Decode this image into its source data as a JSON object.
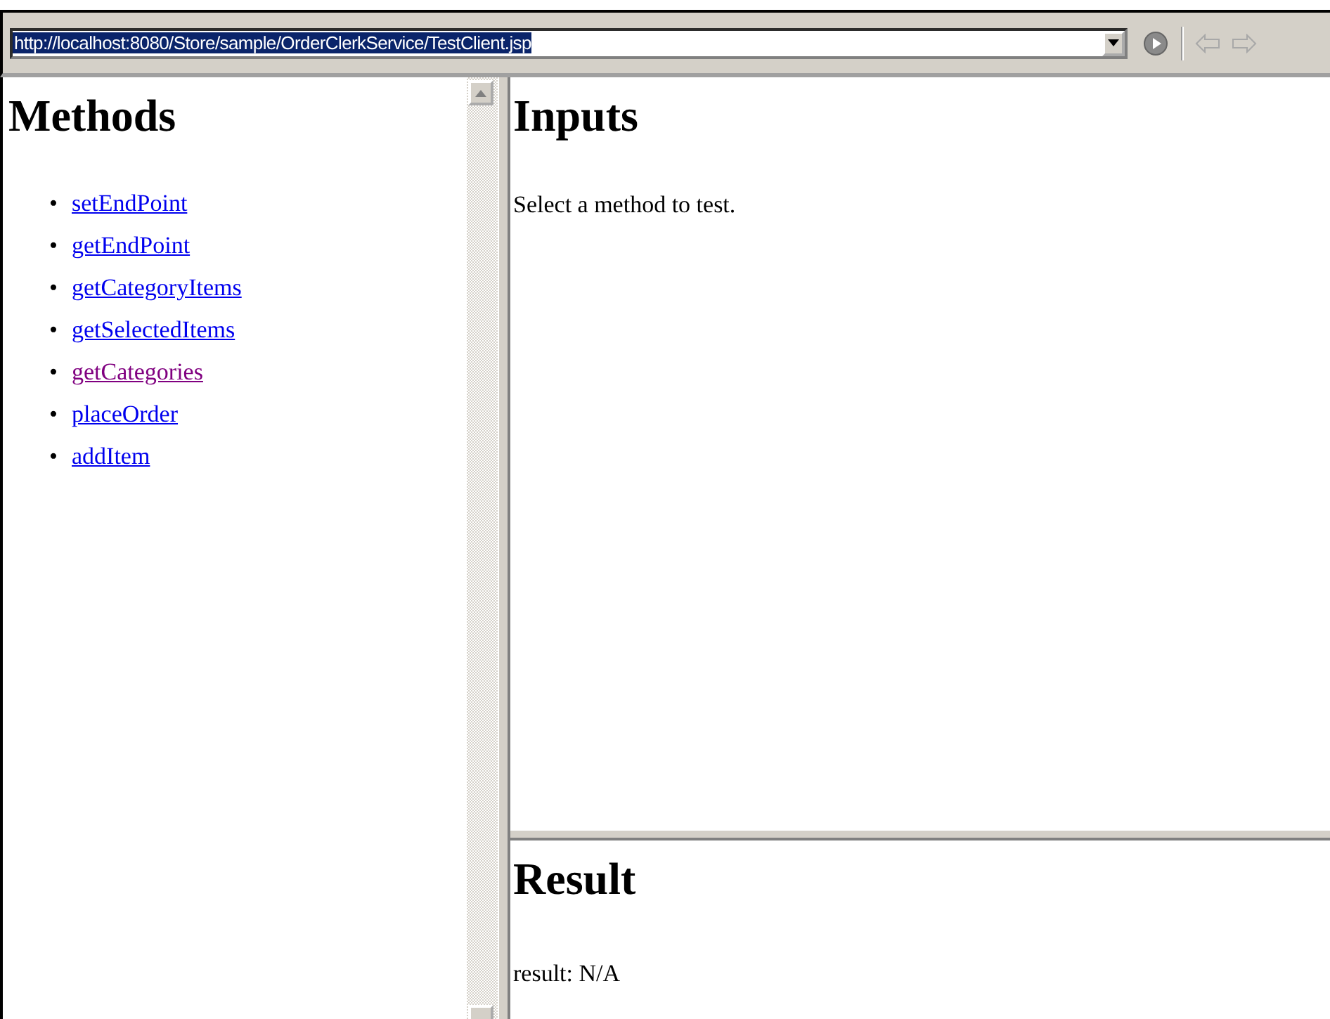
{
  "address_bar": {
    "url": "http://localhost:8080/Store/sample/OrderClerkService/TestClient.jsp",
    "selected": true
  },
  "methods_frame": {
    "title": "Methods",
    "bullet": "•",
    "links": [
      {
        "label": "setEndPoint",
        "visited": false
      },
      {
        "label": "getEndPoint",
        "visited": false
      },
      {
        "label": "getCategoryItems",
        "visited": false
      },
      {
        "label": "getSelectedItems",
        "visited": false
      },
      {
        "label": "getCategories",
        "visited": true
      },
      {
        "label": "placeOrder",
        "visited": false
      },
      {
        "label": "addItem",
        "visited": false
      }
    ]
  },
  "inputs_frame": {
    "title": "Inputs",
    "message": "Select a method to test."
  },
  "result_frame": {
    "title": "Result",
    "message": "result: N/A"
  }
}
